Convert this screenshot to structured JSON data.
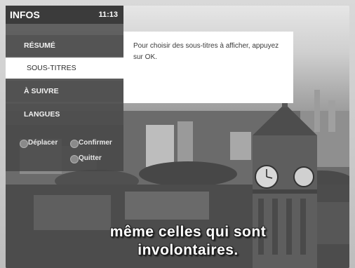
{
  "menu": {
    "title": "INFOS",
    "time": "11:13",
    "items": [
      {
        "label": "RÉSUMÉ"
      },
      {
        "label": "SOUS-TITRES"
      },
      {
        "label": "À SUIVRE"
      },
      {
        "label": "LANGUES"
      }
    ],
    "hints": {
      "move": "Déplacer",
      "confirm": "Confirmer",
      "quit": "Quitter"
    }
  },
  "info_box": {
    "text": "Pour choisir des sous-titres à afficher, appuyez sur OK."
  },
  "subtitles": {
    "line1": "même celles qui sont",
    "line2": "involontaires."
  }
}
